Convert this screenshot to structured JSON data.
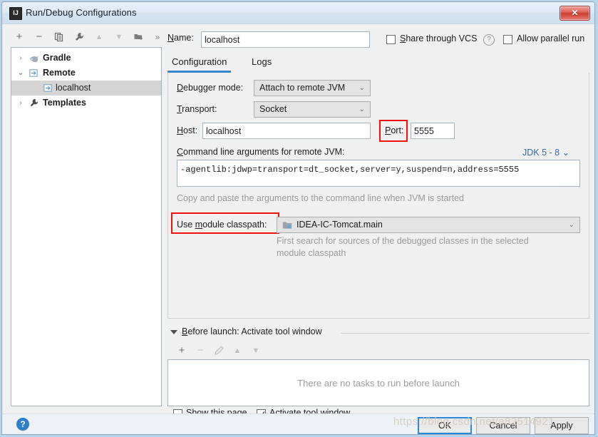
{
  "window": {
    "title": "Run/Debug Configurations",
    "app_icon": "IJ",
    "close_icon": "✕"
  },
  "left_toolbar": {
    "buttons": [
      {
        "name": "add-configuration-button",
        "glyph": "+",
        "enabled": true
      },
      {
        "name": "remove-configuration-button",
        "glyph": "−",
        "enabled": true
      },
      {
        "name": "copy-configuration-button",
        "glyph": "copy-icon",
        "enabled": true
      },
      {
        "name": "edit-templates-button",
        "glyph": "wrench-icon",
        "enabled": true
      },
      {
        "name": "move-up-button",
        "glyph": "▲",
        "enabled": false
      },
      {
        "name": "move-down-button",
        "glyph": "▼",
        "enabled": false
      },
      {
        "name": "new-folder-button",
        "glyph": "folder-add-icon",
        "enabled": true
      },
      {
        "name": "more-options-button",
        "glyph": "»",
        "enabled": true
      }
    ]
  },
  "tree": {
    "items": [
      {
        "label": "Gradle",
        "twisty": "›",
        "indent": 0,
        "icon": "gradle-icon",
        "bold": true,
        "selected": false
      },
      {
        "label": "Remote",
        "twisty": "⌄",
        "indent": 0,
        "icon": "remote-icon",
        "bold": true,
        "selected": false
      },
      {
        "label": "localhost",
        "twisty": "",
        "indent": 1,
        "icon": "remote-icon",
        "bold": false,
        "selected": true
      },
      {
        "label": "Templates",
        "twisty": "›",
        "indent": 0,
        "icon": "wrench-icon",
        "bold": true,
        "selected": false
      }
    ]
  },
  "name_row": {
    "label": "Name:",
    "value": "localhost",
    "placeholder": "",
    "share_vcs_label": "Share through VCS",
    "share_vcs_checked": false,
    "help_glyph": "?",
    "allow_parallel_label": "Allow parallel run",
    "allow_parallel_checked": false
  },
  "tabs": [
    {
      "label": "Configuration",
      "active": true
    },
    {
      "label": "Logs",
      "active": false
    }
  ],
  "config": {
    "debugger_mode_label": "Debugger mode:",
    "debugger_mode_value": "Attach to remote JVM",
    "transport_label": "Transport:",
    "transport_value": "Socket",
    "host_label": "Host:",
    "host_value": "localhost",
    "port_label": "Port:",
    "port_value": "5555",
    "args_label": "Command line arguments for remote JVM:",
    "jdk_selector": "JDK 5 - 8",
    "jdk_chevron": "⌄",
    "args_value": "-agentlib:jdwp=transport=dt_socket,server=y,suspend=n,address=5555",
    "copy_hint": "Copy and paste the arguments to the command line when JVM is started",
    "module_classpath_label": "Use module classpath:",
    "module_classpath_value": "IDEA-IC-Tomcat.main",
    "module_hint_line1": "First search for sources of the debugged classes in the selected",
    "module_hint_line2": "module classpath",
    "chevron": "⌄"
  },
  "before_launch": {
    "title": "Before launch: Activate tool window",
    "toolbar": [
      {
        "name": "add-task-button",
        "glyph": "+",
        "enabled": true
      },
      {
        "name": "remove-task-button",
        "glyph": "−",
        "enabled": false
      },
      {
        "name": "edit-task-button",
        "glyph": "pencil-icon",
        "enabled": false
      },
      {
        "name": "task-move-up-button",
        "glyph": "▲",
        "enabled": false
      },
      {
        "name": "task-move-down-button",
        "glyph": "▼",
        "enabled": false
      }
    ],
    "empty_text": "There are no tasks to run before launch",
    "show_page_label": "Show this page",
    "show_page_checked": false,
    "activate_tool_window_label": "Activate tool window",
    "activate_tool_window_checked": true
  },
  "footer": {
    "help_glyph": "?",
    "ok_label": "OK",
    "cancel_label": "Cancel",
    "apply_label": "Apply"
  },
  "watermark": "https://blog.csdn.net/a82514921",
  "colors": {
    "accent": "#3a86cf",
    "highlight_box": "#f40f0f",
    "link": "#2f6bb0"
  }
}
